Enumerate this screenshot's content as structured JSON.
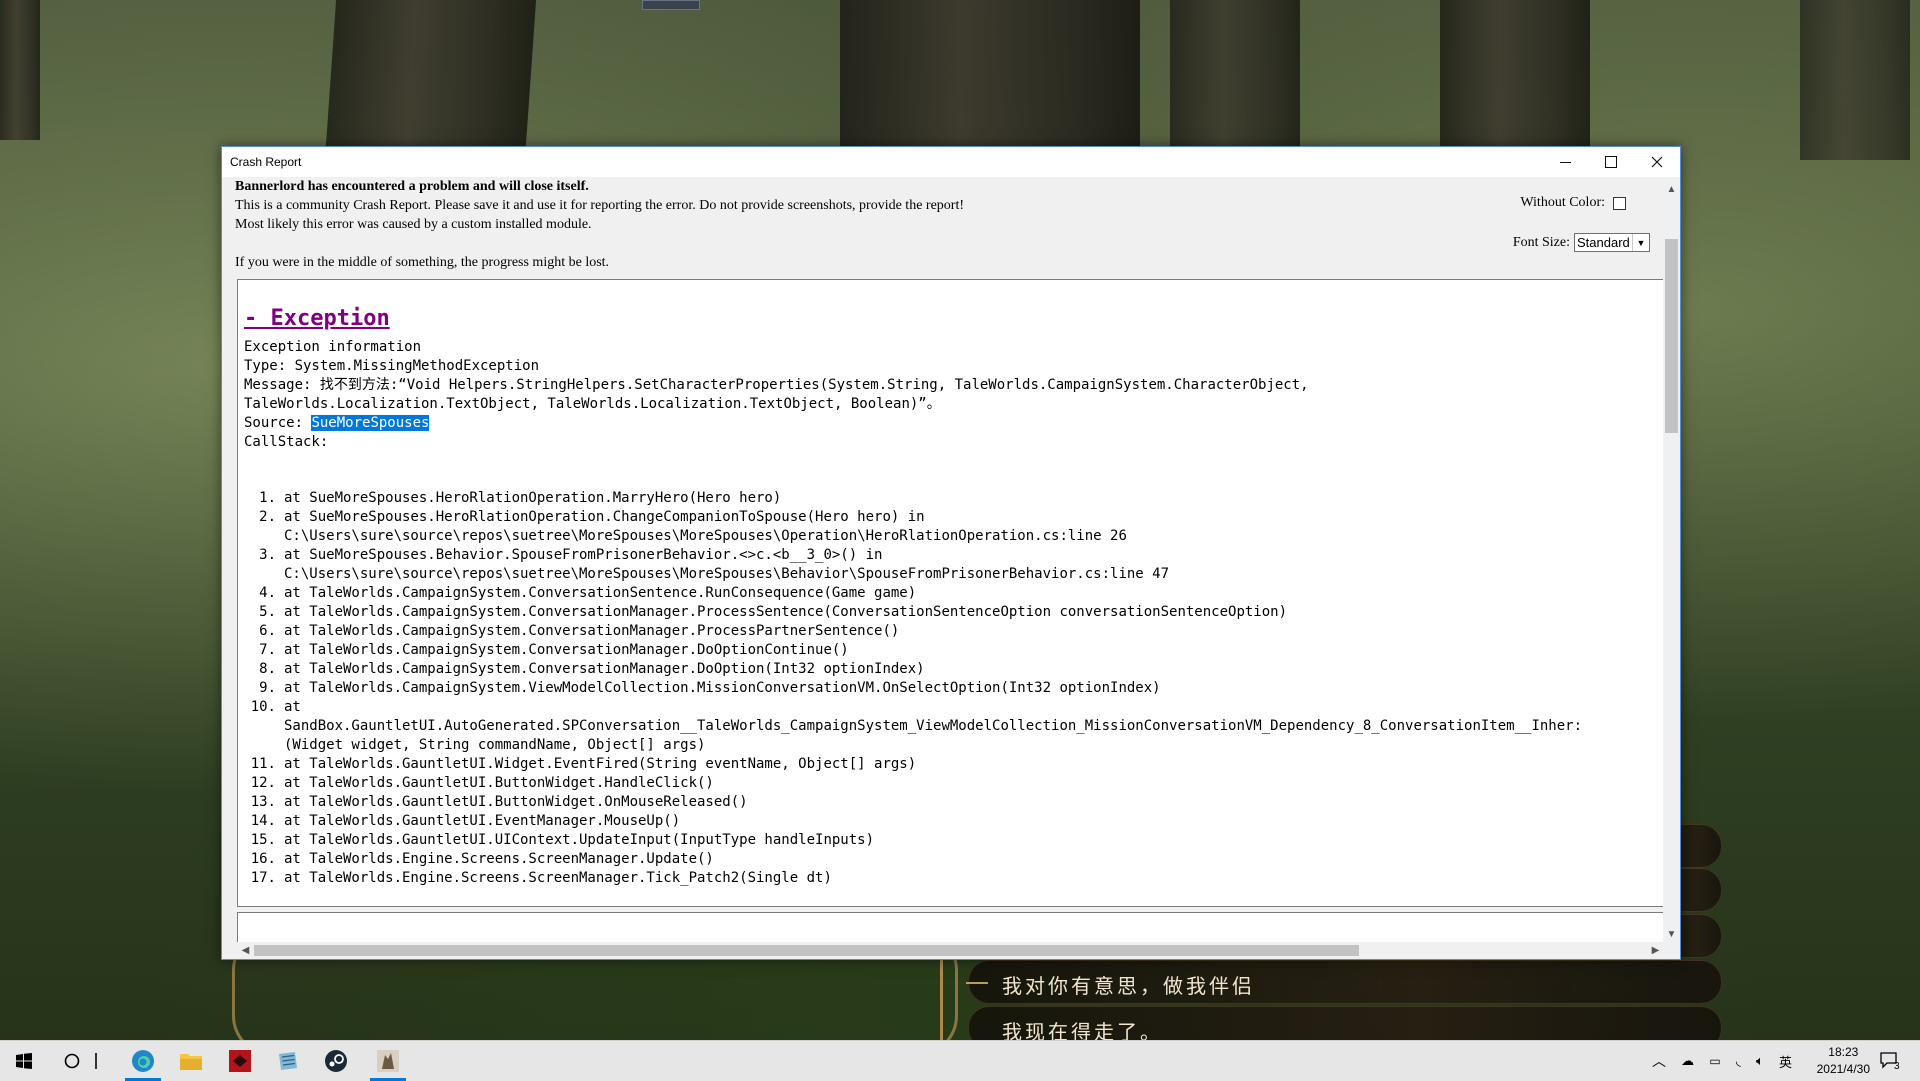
{
  "window": {
    "title": "Crash Report",
    "header": {
      "line1": "Bannerlord has encountered a problem and will close itself.",
      "line2": "This is a community Crash Report. Please save it and use it for reporting the error. Do not provide screenshots, provide the report!",
      "line3": "Most likely this error was caused by a custom installed module.",
      "line4": "If you were in the middle of something, the progress might be lost."
    },
    "options": {
      "without_color_label": "Without Color:",
      "font_size_label": "Font Size:",
      "font_size_value": "Standard"
    },
    "exception": {
      "title": "- Exception",
      "info": "Exception information",
      "type": "Type: System.MissingMethodException",
      "message_line1": "Message: 找不到方法:“Void Helpers.StringHelpers.SetCharacterProperties(System.String, TaleWorlds.CampaignSystem.CharacterObject,",
      "message_line2": "TaleWorlds.Localization.TextObject, TaleWorlds.Localization.TextObject, Boolean)”。",
      "source_label": "Source: ",
      "source_value": "SueMoreSpouses",
      "callstack_label": "CallStack:"
    },
    "callstack": [
      {
        "n": "1.",
        "lines": [
          "at SueMoreSpouses.HeroRlationOperation.MarryHero(Hero hero)"
        ]
      },
      {
        "n": "2.",
        "lines": [
          "at SueMoreSpouses.HeroRlationOperation.ChangeCompanionToSpouse(Hero hero) in",
          "C:\\Users\\sure\\source\\repos\\suetree\\MoreSpouses\\MoreSpouses\\Operation\\HeroRlationOperation.cs:line 26"
        ]
      },
      {
        "n": "3.",
        "lines": [
          "at SueMoreSpouses.Behavior.SpouseFromPrisonerBehavior.<>c.<b__3_0>() in",
          "C:\\Users\\sure\\source\\repos\\suetree\\MoreSpouses\\MoreSpouses\\Behavior\\SpouseFromPrisonerBehavior.cs:line 47"
        ]
      },
      {
        "n": "4.",
        "lines": [
          "at TaleWorlds.CampaignSystem.ConversationSentence.RunConsequence(Game game)"
        ]
      },
      {
        "n": "5.",
        "lines": [
          "at TaleWorlds.CampaignSystem.ConversationManager.ProcessSentence(ConversationSentenceOption conversationSentenceOption)"
        ]
      },
      {
        "n": "6.",
        "lines": [
          "at TaleWorlds.CampaignSystem.ConversationManager.ProcessPartnerSentence()"
        ]
      },
      {
        "n": "7.",
        "lines": [
          "at TaleWorlds.CampaignSystem.ConversationManager.DoOptionContinue()"
        ]
      },
      {
        "n": "8.",
        "lines": [
          "at TaleWorlds.CampaignSystem.ConversationManager.DoOption(Int32 optionIndex)"
        ]
      },
      {
        "n": "9.",
        "lines": [
          "at TaleWorlds.CampaignSystem.ViewModelCollection.MissionConversationVM.OnSelectOption(Int32 optionIndex)"
        ]
      },
      {
        "n": "10.",
        "lines": [
          "at",
          "SandBox.GauntletUI.AutoGenerated.SPConversation__TaleWorlds_CampaignSystem_ViewModelCollection_MissionConversationVM_Dependency_8_ConversationItem__Inher:",
          "(Widget widget, String commandName, Object[] args)"
        ]
      },
      {
        "n": "11.",
        "lines": [
          "at TaleWorlds.GauntletUI.Widget.EventFired(String eventName, Object[] args)"
        ]
      },
      {
        "n": "12.",
        "lines": [
          "at TaleWorlds.GauntletUI.ButtonWidget.HandleClick()"
        ]
      },
      {
        "n": "13.",
        "lines": [
          "at TaleWorlds.GauntletUI.ButtonWidget.OnMouseReleased()"
        ]
      },
      {
        "n": "14.",
        "lines": [
          "at TaleWorlds.GauntletUI.EventManager.MouseUp()"
        ]
      },
      {
        "n": "15.",
        "lines": [
          "at TaleWorlds.GauntletUI.UIContext.UpdateInput(InputType handleInputs)"
        ]
      },
      {
        "n": "16.",
        "lines": [
          "at TaleWorlds.Engine.Screens.ScreenManager.Update()"
        ]
      },
      {
        "n": "17.",
        "lines": [
          "at TaleWorlds.Engine.Screens.ScreenManager.Tick_Patch2(Single dt)"
        ]
      }
    ]
  },
  "game": {
    "dialog_option_1": "我对你有意思，做我伴侣",
    "dialog_option_2": "我现在得走了。"
  },
  "taskbar": {
    "ime": "英",
    "time": "18:23",
    "date": "2021/4/30",
    "notification_count": "3"
  },
  "colors": {
    "accent": "#0078d7",
    "exception_title": "#800080",
    "window_border": "#5b8ad0"
  }
}
